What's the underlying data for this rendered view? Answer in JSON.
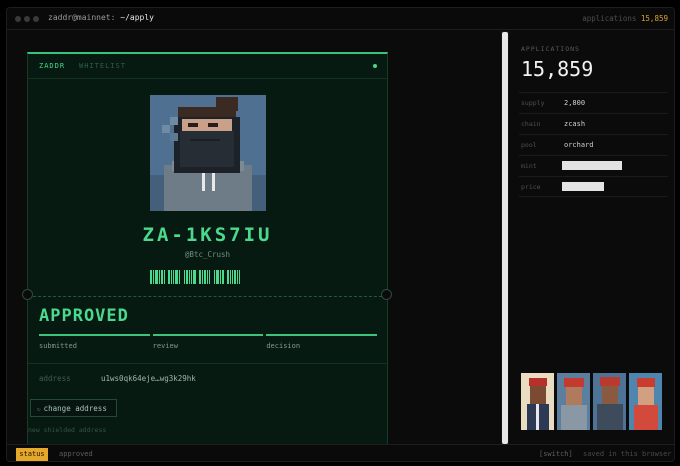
{
  "titlebar": {
    "user_host": "zaddr@mainnet: ",
    "path": "~/apply",
    "apps_label": "applications",
    "apps_count": "15,859"
  },
  "card": {
    "brand": "ZADDR",
    "tag": "WHITELIST",
    "token_id": "ZA-1KS7IU",
    "handle": "@Btc_Crush",
    "status": "APPROVED",
    "steps": [
      "submitted",
      "review",
      "decision"
    ],
    "address_label": "address",
    "address_value": "u1ws0qk64eje…wg3k29hk",
    "change_button": "change address",
    "shield_note": "new shielded address"
  },
  "panel": {
    "label": "APPLICATIONS",
    "count": "15,859",
    "rows": [
      {
        "key": "supply",
        "value": "2,800"
      },
      {
        "key": "chain",
        "value": "zcash"
      },
      {
        "key": "pool",
        "value": "orchard"
      },
      {
        "key": "mint",
        "value": ""
      },
      {
        "key": "price",
        "value": ""
      }
    ]
  },
  "statusbar": {
    "button": "status",
    "state": "approved",
    "switch": "[switch]",
    "saved": "saved in this browser"
  },
  "colors": {
    "accent_green": "#4bd98d",
    "amber": "#e6a82b",
    "card_bg": "#071a11"
  },
  "icons": [
    "window-dot-icon",
    "refresh-icon",
    "status-led-icon"
  ]
}
